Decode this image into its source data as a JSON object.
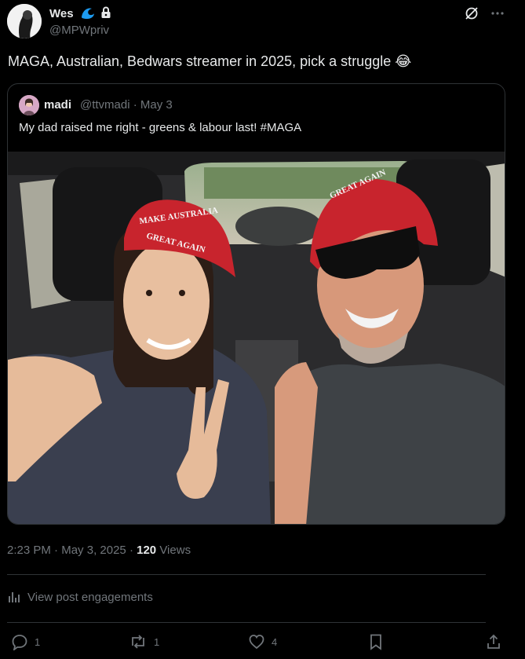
{
  "author": {
    "name": "Wes",
    "handle": "@MPWpriv",
    "badge_icons": [
      "wave-icon",
      "lock-icon"
    ]
  },
  "tweet": {
    "text": "MAGA, Australian, Bedwars streamer in 2025, pick a struggle 😂"
  },
  "quote": {
    "name": "madi",
    "handle": "@ttvmadi",
    "date": "May 3",
    "text": "My dad raised me right - greens & labour last! #MAGA",
    "photo": {
      "hat_left_text": [
        "MAKE AUSTRALIA",
        "GREAT AGAIN"
      ],
      "hat_right_text": [
        "GREAT AGAIN"
      ]
    }
  },
  "timestamp": {
    "time": "2:23 PM",
    "date": "May 3, 2025",
    "views": "120",
    "views_label": "Views"
  },
  "engagements": {
    "label": "View post engagements"
  },
  "actions": {
    "replies": "1",
    "reposts": "1",
    "likes": "4"
  },
  "colors": {
    "background": "#000000",
    "text": "#e7e9ea",
    "muted": "#71767b",
    "border": "#2f3336",
    "accent_blue": "#1d9bf0"
  }
}
